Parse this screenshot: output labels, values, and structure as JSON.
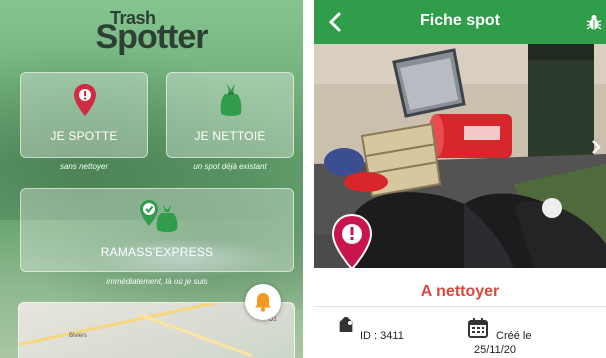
{
  "home": {
    "logo": {
      "small": "Trash",
      "big": "Spotter"
    },
    "buttons": [
      {
        "label": "JE SPOTTE",
        "sub": "sans nettoyer"
      },
      {
        "label": "JE NETTOIE",
        "sub": "un spot déjà existant"
      },
      {
        "label": "RAMASS'EXPRESS",
        "sub": "immédiatement, là où je suis"
      }
    ],
    "map": {
      "place": "Biviers",
      "road": "D1"
    }
  },
  "spot": {
    "title": "Fiche spot",
    "status": "A nettoyer",
    "id_label": "ID : 3411",
    "created_label": "Créé le",
    "created_date": "25/11/20"
  },
  "colors": {
    "primary_green": "#2f9d4a",
    "danger_red": "#d9483b",
    "pin_magenta": "#c8154e",
    "bell_orange": "#f39a1e"
  },
  "icons": {
    "back": "chevron-left-icon",
    "bug": "bug-icon",
    "spot_pin": "location-pin-icon",
    "trash_bag": "trash-bag-icon",
    "express": "check-pin-bag-icon",
    "bell": "bell-icon",
    "tag": "tag-icon",
    "calendar": "calendar-icon"
  }
}
